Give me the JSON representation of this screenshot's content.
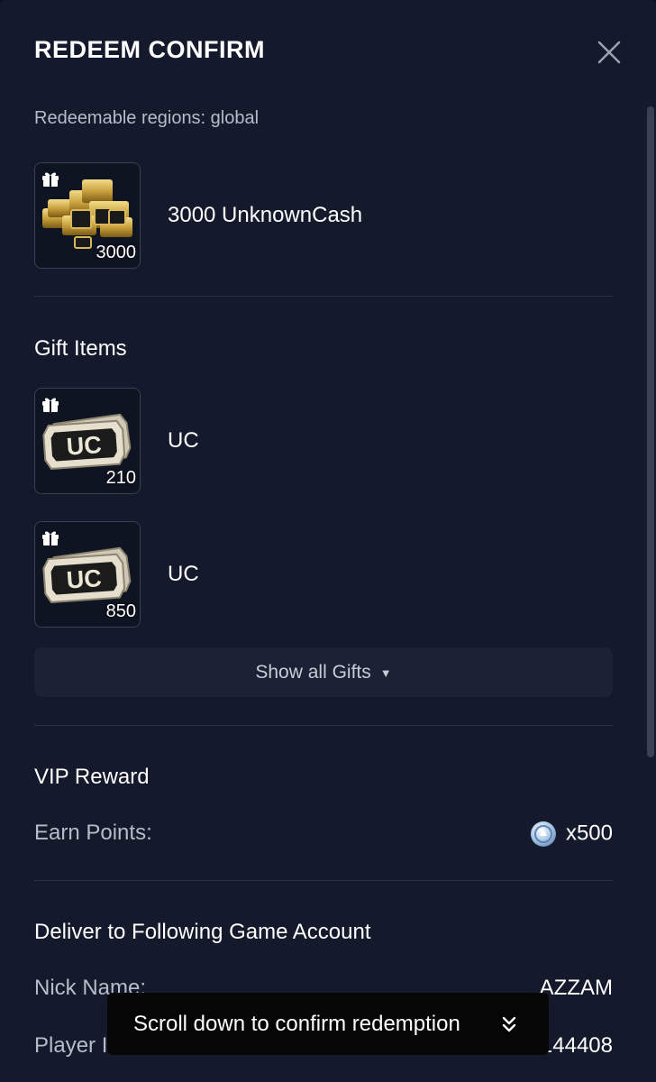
{
  "modal": {
    "title": "REDEEM CONFIRM",
    "regions_text": "Redeemable regions: global"
  },
  "main_item": {
    "name": "3000 UnknownCash",
    "quantity": "3000",
    "icon": "gold-coins-icon"
  },
  "gifts": {
    "section_title": "Gift Items",
    "items": [
      {
        "name": "UC",
        "quantity": "210",
        "icon": "uc-ticket-icon"
      },
      {
        "name": "UC",
        "quantity": "850",
        "icon": "uc-ticket-icon"
      }
    ],
    "show_all_label": "Show all Gifts"
  },
  "vip": {
    "section_title": "VIP Reward",
    "earn_label": "Earn Points:",
    "earn_value": "x500",
    "icon": "vip-points-icon"
  },
  "account": {
    "section_title": "Deliver to Following Game Account",
    "nick_label": "Nick Name:",
    "nick_value": "AZZAM",
    "player_id_label": "Player ID:",
    "player_id_value": "5973144408"
  },
  "toast": {
    "text": "Scroll down to confirm redemption",
    "icon": "double-chevron-down-icon"
  },
  "colors": {
    "background": "#141a2c",
    "divider": "#2a3042",
    "button_bg": "#1b2235",
    "toast_bg": "#060606"
  }
}
